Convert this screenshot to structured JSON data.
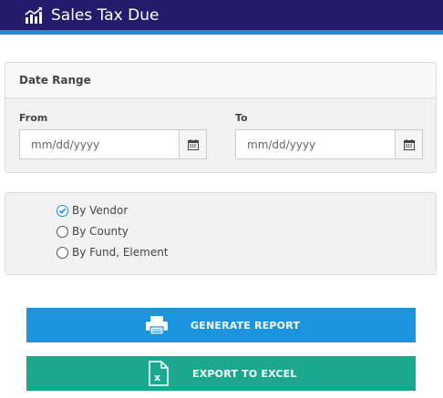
{
  "header": {
    "title": "Sales Tax Due",
    "icon": "chart-trend-icon",
    "bg_color": "#231c6b",
    "accent_color": "#1a8fd6"
  },
  "date_range": {
    "heading": "Date Range",
    "from": {
      "label": "From",
      "placeholder": "mm/dd/yyyy",
      "value": ""
    },
    "to": {
      "label": "To",
      "placeholder": "mm/dd/yyyy",
      "value": ""
    },
    "icon": "calendar-icon"
  },
  "group_by": {
    "options": [
      {
        "label": "By Vendor",
        "selected": true
      },
      {
        "label": "By County",
        "selected": false
      },
      {
        "label": "By Fund, Element",
        "selected": false
      }
    ],
    "accent_color": "#1a8fd6"
  },
  "actions": {
    "generate_label": "GENERATE REPORT",
    "generate_icon": "printer-icon",
    "generate_color": "#1a95dd",
    "export_label": "EXPORT TO EXCEL",
    "export_icon": "excel-file-icon",
    "export_color": "#1aa98e"
  }
}
